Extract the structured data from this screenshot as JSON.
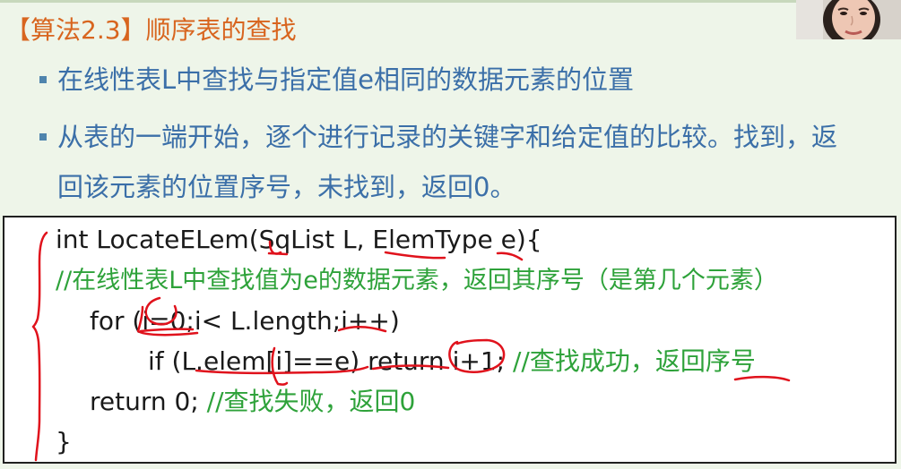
{
  "slide": {
    "title": "【算法2.3】顺序表的查找",
    "bullets": [
      "在线性表L中查找与指定值e相同的数据元素的位置",
      "从表的一端开始，逐个进行记录的关键字和给定值的比较。找到，返",
      "回该元素的位置序号，未找到，返回0。"
    ]
  },
  "code": {
    "line1": "int LocateELem(SqList L, ElemType e){",
    "line2_comment": "//在线性表L中查找值为e的数据元素，返回其序号（是第几个元素）",
    "line3": "for (i=0;i< L.length;i++)",
    "line4_code": "if (L.elem[i]==e) return i+1;",
    "line4_comment": " //查找成功，返回序号",
    "line5_code": "return 0;",
    "line5_comment": " //查找失败，返回0",
    "line6": "}"
  },
  "colors": {
    "title": "#d8651f",
    "bullet_text": "#3b6fa8",
    "comment": "#2ea23a",
    "annotation_ink": "#e0121c",
    "background": "#eef5e9"
  }
}
